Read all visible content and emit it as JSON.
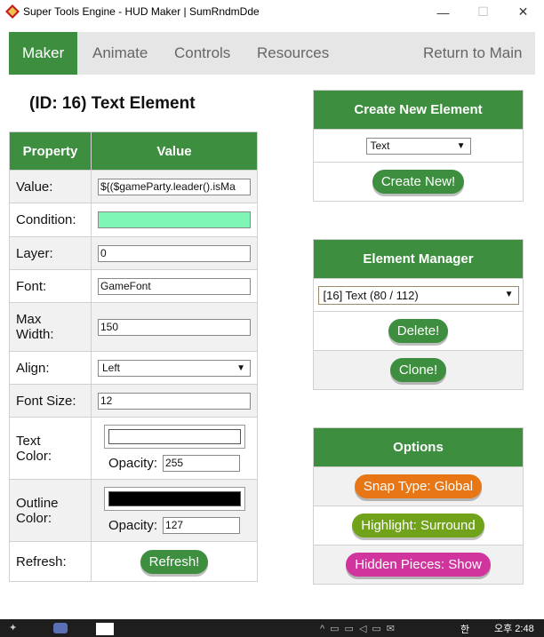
{
  "window": {
    "title": "Super Tools Engine  -  HUD Maker  |  SumRndmDde",
    "minimize": "—",
    "maximize": "☐",
    "close": "✕"
  },
  "nav": {
    "tabs": [
      {
        "label": "Maker",
        "active": true
      },
      {
        "label": "Animate"
      },
      {
        "label": "Controls"
      },
      {
        "label": "Resources"
      }
    ],
    "return_label": "Return to Main"
  },
  "element": {
    "heading": "(ID: 16) Text Element"
  },
  "properties": {
    "header_property": "Property",
    "header_value": "Value",
    "value_label": "Value:",
    "value": "${($gameParty.leader().isMa",
    "condition_label": "Condition:",
    "condition": "",
    "layer_label": "Layer:",
    "layer": "0",
    "font_label": "Font:",
    "font": "GameFont",
    "maxwidth_label_1": "Max",
    "maxwidth_label_2": "Width:",
    "maxwidth": "150",
    "align_label": "Align:",
    "align": "Left",
    "fontsize_label": "Font Size:",
    "fontsize": "12",
    "textcolor_label_1": "Text",
    "textcolor_label_2": "Color:",
    "textcolor": "#ffffff",
    "text_opacity_label": "Opacity:",
    "text_opacity": "255",
    "outlinecolor_label_1": "Outline",
    "outlinecolor_label_2": "Color:",
    "outlinecolor": "#000000",
    "outline_opacity_label": "Opacity:",
    "outline_opacity": "127",
    "refresh_label": "Refresh:",
    "refresh_button": "Refresh!"
  },
  "create_panel": {
    "title": "Create New Element",
    "type_selected": "Text",
    "create_button": "Create New!"
  },
  "manager_panel": {
    "title": "Element Manager",
    "selected": "[16] Text (80 / 112)",
    "delete_button": "Delete!",
    "clone_button": "Clone!"
  },
  "options_panel": {
    "title": "Options",
    "snap_button": "Snap Type: Global",
    "highlight_button": "Highlight: Surround",
    "hidden_button": "Hidden Pieces: Show"
  },
  "taskbar": {
    "time": "오후 2:48",
    "lang": "한"
  },
  "colors": {
    "accent": "#3d8f3f",
    "condition_fill": "#7ff5b6",
    "snap": "#e87615",
    "highlight": "#71a31a",
    "hidden": "#d1349c"
  }
}
